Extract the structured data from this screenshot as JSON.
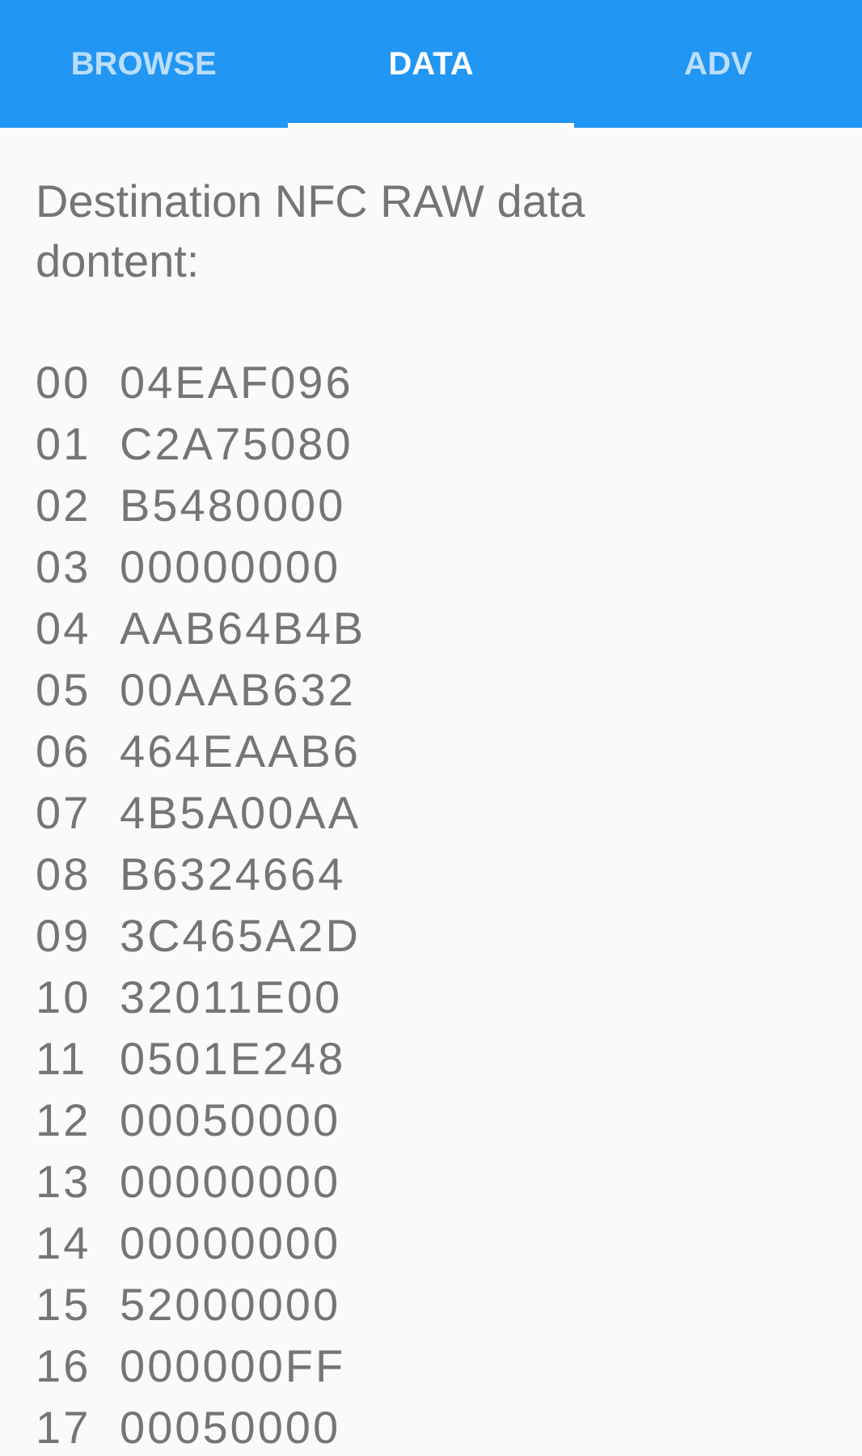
{
  "tabs": [
    {
      "label": "BROWSE",
      "selected": false
    },
    {
      "label": "DATA",
      "selected": true
    },
    {
      "label": "ADV",
      "selected": false
    }
  ],
  "heading": "Destination NFC RAW data dontent:",
  "rows": [
    {
      "page": "00",
      "value": "04EAF096"
    },
    {
      "page": "01",
      "value": "C2A75080"
    },
    {
      "page": "02",
      "value": "B5480000"
    },
    {
      "page": "03",
      "value": "00000000"
    },
    {
      "page": "04",
      "value": "AAB64B4B"
    },
    {
      "page": "05",
      "value": "00AAB632"
    },
    {
      "page": "06",
      "value": "464EAAB6"
    },
    {
      "page": "07",
      "value": "4B5A00AA"
    },
    {
      "page": "08",
      "value": "B6324664"
    },
    {
      "page": "09",
      "value": "3C465A2D"
    },
    {
      "page": "10",
      "value": "32011E00"
    },
    {
      "page": "11",
      "value": "0501E248"
    },
    {
      "page": "12",
      "value": "00050000"
    },
    {
      "page": "13",
      "value": "00000000"
    },
    {
      "page": "14",
      "value": "00000000"
    },
    {
      "page": "15",
      "value": "52000000"
    },
    {
      "page": "16",
      "value": "000000FF"
    },
    {
      "page": "17",
      "value": "00050000"
    }
  ]
}
